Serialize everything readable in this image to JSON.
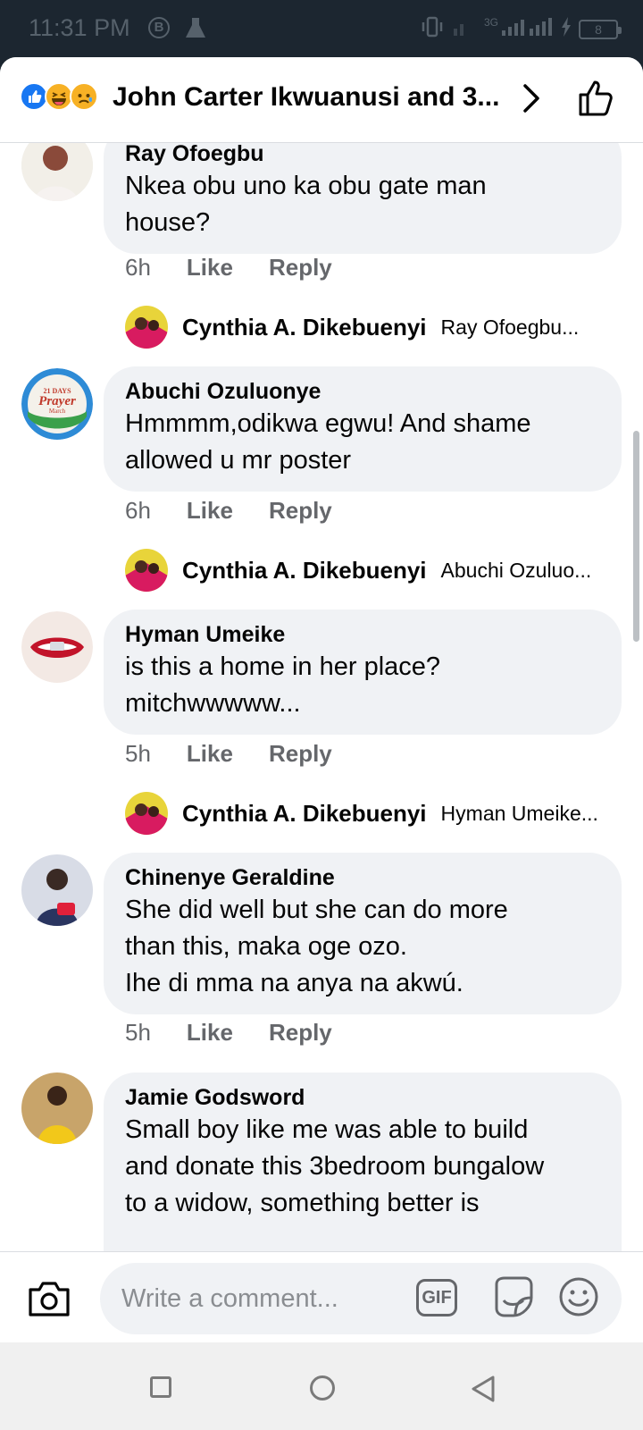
{
  "status_bar": {
    "time": "11:31 PM",
    "b_badge": "B",
    "network": "3G",
    "battery": "8"
  },
  "header": {
    "title": "John Carter Ikwuanusi and 3...",
    "reactions": [
      "like",
      "haha",
      "sad"
    ]
  },
  "comments": [
    {
      "author": "Ray Ofoegbu",
      "text": "Nkea obu uno ka obu gate man\nhouse?",
      "time": "6h",
      "like_label": "Like",
      "reply_label": "Reply",
      "reply_preview": {
        "author": "Cynthia A. Dikebuenyi",
        "snippet": "Ray Ofoegbu..."
      }
    },
    {
      "author": "Abuchi Ozuluonye",
      "text": "Hmmmm,odikwa egwu! And shame\nallowed u mr poster",
      "time": "6h",
      "like_label": "Like",
      "reply_label": "Reply",
      "reply_preview": {
        "author": "Cynthia A. Dikebuenyi",
        "snippet": "Abuchi Ozuluo..."
      }
    },
    {
      "author": "Hyman Umeike",
      "text": "is this a home in her place?\nmitchwwwww...",
      "time": "5h",
      "like_label": "Like",
      "reply_label": "Reply",
      "reply_preview": {
        "author": "Cynthia A. Dikebuenyi",
        "snippet": "Hyman Umeike..."
      }
    },
    {
      "author": "Chinenye Geraldine",
      "text": "She did well but she can do more\nthan this, maka oge ozo.\nIhe di mma na anya na akwú.",
      "time": "5h",
      "like_label": "Like",
      "reply_label": "Reply"
    },
    {
      "author": "Jamie Godsword",
      "text": "Small boy like me was able to build\nand donate this 3bedroom bungalow\nto a widow, something better is"
    }
  ],
  "avatar_badge": {
    "line1": "21 DAYS",
    "line2": "Prayer",
    "line3": "March"
  },
  "composer": {
    "placeholder": "Write a comment...",
    "gif_label": "GIF"
  },
  "colors": {
    "accent": "#1877f2",
    "bubble": "#f0f2f5",
    "meta": "#65676b"
  }
}
